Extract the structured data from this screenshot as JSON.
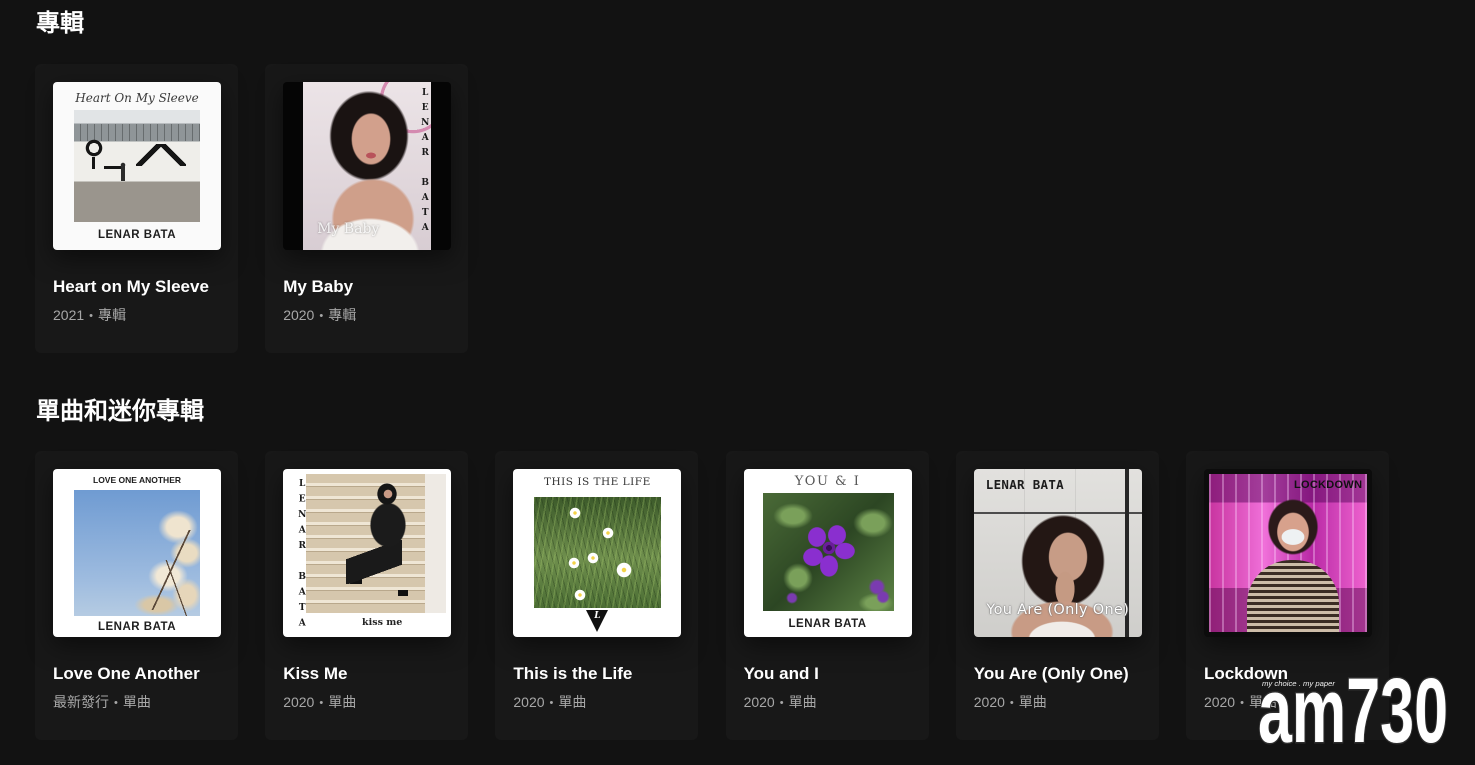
{
  "theme": {
    "background": "#121212",
    "card": "#181818",
    "title_text": "#ffffff",
    "meta_text": "#a7a7a7"
  },
  "meta_separator": "•",
  "sections": [
    {
      "title": "專輯",
      "items": [
        {
          "title": "Heart on My Sleeve",
          "release": "2021",
          "type": "專輯",
          "cover": {
            "title": "Heart On My Sleeve",
            "artist": "LENAR BATA"
          }
        },
        {
          "title": "My Baby",
          "release": "2020",
          "type": "專輯",
          "cover": {
            "title": "My Baby",
            "artist": "LENAR BATA"
          }
        }
      ]
    },
    {
      "title": "單曲和迷你專輯",
      "items": [
        {
          "title": "Love One Another",
          "release": "最新發行",
          "type": "單曲",
          "cover": {
            "title": "LOVE ONE ANOTHER",
            "artist": "LENAR BATA"
          }
        },
        {
          "title": "Kiss Me",
          "release": "2020",
          "type": "單曲",
          "cover": {
            "title": "kiss me",
            "artist": "LENAR BATA"
          }
        },
        {
          "title": "This is the Life",
          "release": "2020",
          "type": "單曲",
          "cover": {
            "title": "THIS IS THE LIFE",
            "logo_letter": "L"
          }
        },
        {
          "title": "You and I",
          "release": "2020",
          "type": "單曲",
          "cover": {
            "title": "YOU & I",
            "artist": "LENAR BATA"
          }
        },
        {
          "title": "You Are (Only One)",
          "release": "2020",
          "type": "單曲",
          "cover": {
            "title": "You Are (Only One)",
            "artist": "LENAR BATA"
          }
        },
        {
          "title": "Lockdown",
          "release": "2020",
          "type": "單曲",
          "cover": {
            "title": "LOCKDOWN"
          }
        }
      ]
    }
  ],
  "watermark": {
    "tagline": "my choice . my paper",
    "logo": "am730"
  }
}
